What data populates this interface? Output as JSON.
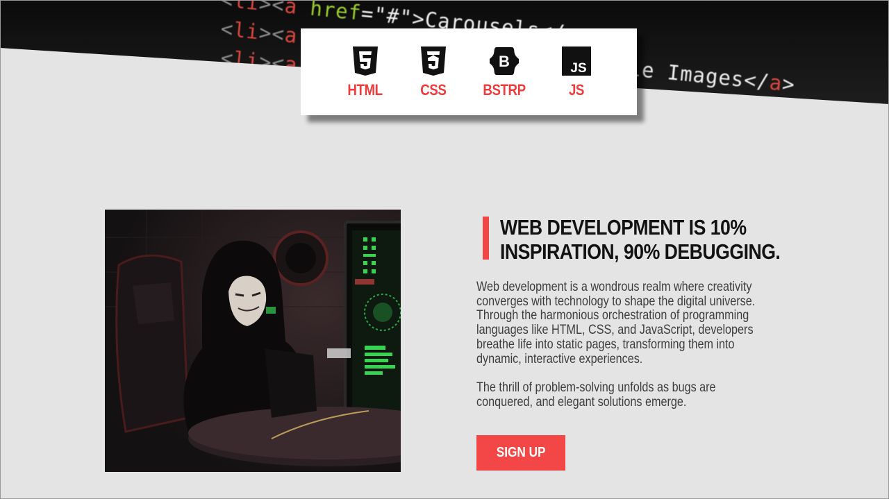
{
  "banner": {
    "code_lines": [
      {
        "text": "  <li><a href=\"#\">Carousels</a></li>"
      },
      {
        "text": "  <li><a href=\"header.html\">Variable Images</a></li>"
      },
      {
        "text": "  <li><a href=\"slider.html\">Testimonial Slider</a></li>"
      }
    ]
  },
  "tech_stack": [
    {
      "label": "HTML",
      "icon": "html5-icon"
    },
    {
      "label": "CSS",
      "icon": "css3-icon"
    },
    {
      "label": "BSTRP",
      "icon": "bootstrap-icon"
    },
    {
      "label": "JS",
      "icon": "javascript-icon"
    }
  ],
  "hero_image": {
    "alt": "hacker-at-computer-image"
  },
  "content": {
    "headline_line1": "WEB DEVELOPMENT IS 10%",
    "headline_line2": "INSPIRATION, 90% DEBUGGING.",
    "paragraph1": [
      "Web development is a wondrous realm where creativity",
      "converges with technology to shape the digital universe.",
      "Through the harmonious orchestration of programming",
      "languages like HTML, CSS, and JavaScript, developers",
      "breathe life into static pages, transforming them into",
      "dynamic, interactive experiences."
    ],
    "paragraph2": [
      "The thrill of problem-solving unfolds as bugs are",
      "conquered, and elegant solutions emerge."
    ],
    "signup_label": "SIGN UP"
  },
  "colors": {
    "accent": "#f34747",
    "background": "#e4e4e4",
    "banner": "#111111",
    "heading": "#121212",
    "body_text": "#3d3d3d"
  }
}
